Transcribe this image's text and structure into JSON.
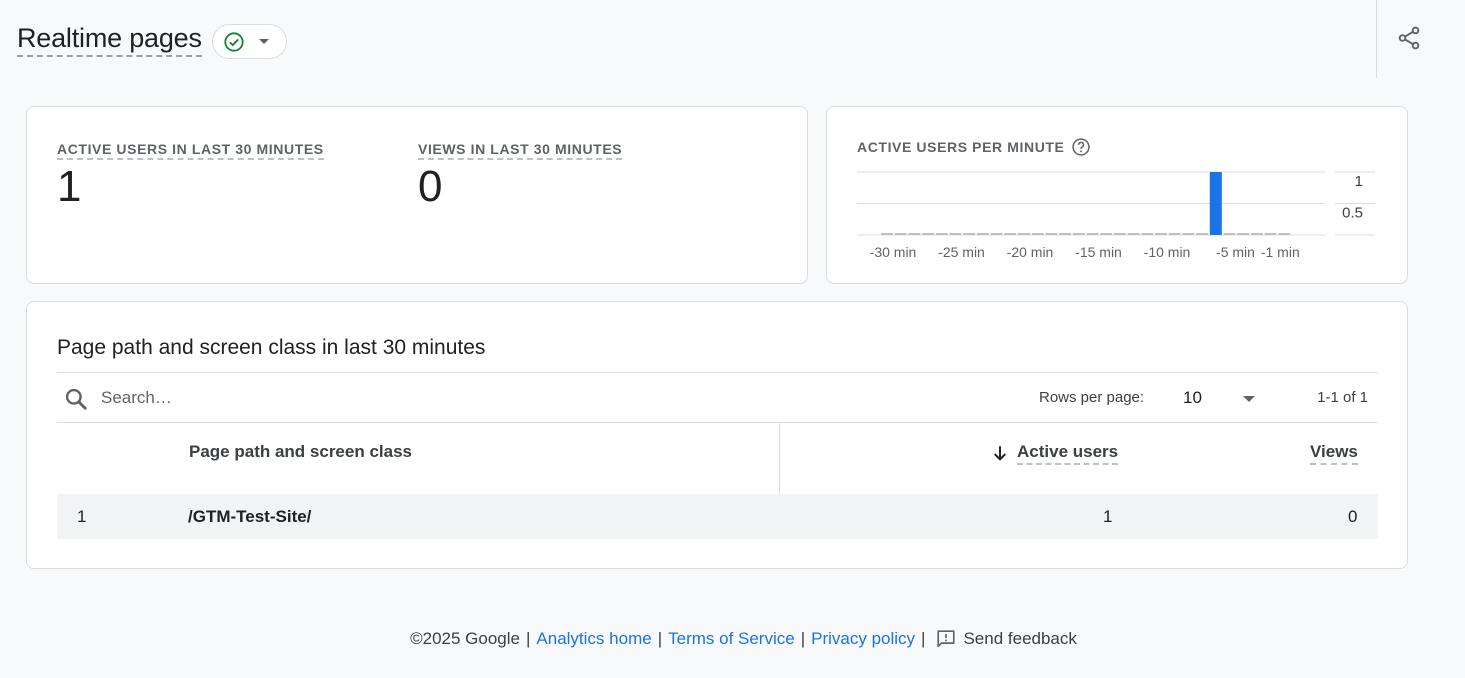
{
  "header": {
    "title": "Realtime pages"
  },
  "metrics": {
    "active_users_label": "Active users in last 30 minutes",
    "active_users_value": "1",
    "views_label": "Views in last 30 minutes",
    "views_value": "0"
  },
  "chart_data": {
    "type": "bar",
    "title": "ACTIVE USERS PER MINUTE",
    "categories": [
      "-30 min",
      "-29 min",
      "-28 min",
      "-27 min",
      "-26 min",
      "-25 min",
      "-24 min",
      "-23 min",
      "-22 min",
      "-21 min",
      "-20 min",
      "-19 min",
      "-18 min",
      "-17 min",
      "-16 min",
      "-15 min",
      "-14 min",
      "-13 min",
      "-12 min",
      "-11 min",
      "-10 min",
      "-9 min",
      "-8 min",
      "-7 min",
      "-6 min",
      "-5 min",
      "-4 min",
      "-3 min",
      "-2 min",
      "-1 min"
    ],
    "values": [
      0,
      0,
      0,
      0,
      0,
      0,
      0,
      0,
      0,
      0,
      0,
      0,
      0,
      0,
      0,
      0,
      0,
      0,
      0,
      0,
      0,
      0,
      0,
      0,
      1,
      0,
      0,
      0,
      0,
      0
    ],
    "x_tick_labels": [
      "-30 min",
      "-25 min",
      "-20 min",
      "-15 min",
      "-10 min",
      "-5 min",
      "-1 min"
    ],
    "y_tick_labels": [
      "1",
      "0.5"
    ],
    "ylim": [
      0,
      1
    ],
    "bar_color": "#1a73e8",
    "grid": true
  },
  "table": {
    "title": "Page path and screen class in last 30 minutes",
    "search_placeholder": "Search…",
    "rows_per_page_label": "Rows per page:",
    "rows_per_page_value": "10",
    "pagination": "1-1 of 1",
    "columns": [
      "Page path and screen class",
      "Active users",
      "Views"
    ],
    "rows": [
      {
        "index": "1",
        "path": "/GTM-Test-Site/",
        "active_users": "1",
        "views": "0"
      }
    ]
  },
  "footer": {
    "copyright": "©2025 Google",
    "analytics_home": "Analytics home",
    "terms": "Terms of Service",
    "privacy": "Privacy policy",
    "feedback": "Send feedback",
    "separator": "|"
  },
  "colors": {
    "accent": "#1a73e8",
    "status_ok": "#188038"
  }
}
